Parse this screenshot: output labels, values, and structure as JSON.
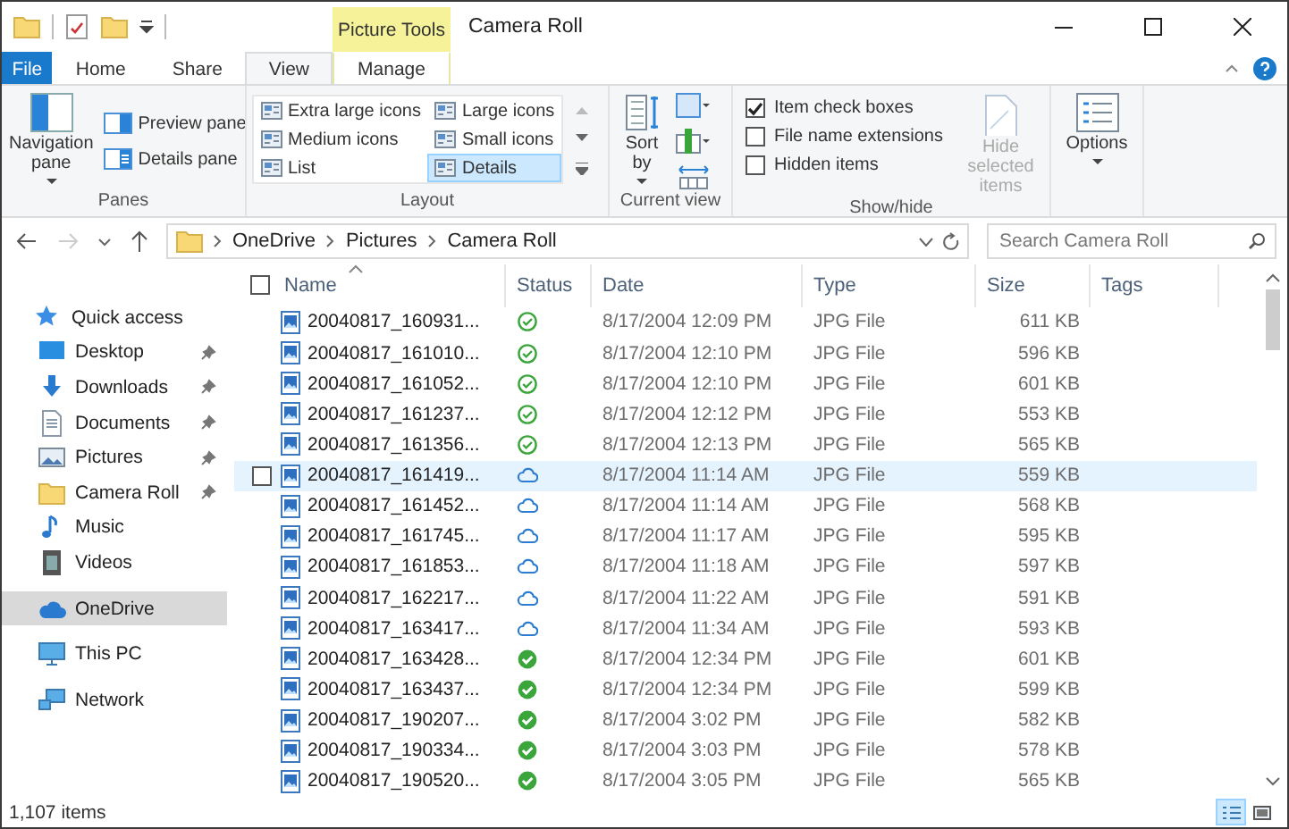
{
  "title_bar": {
    "contextual_tab": "Picture Tools",
    "title": "Camera Roll"
  },
  "ribbon_tabs": [
    {
      "label": "File",
      "kind": "file",
      "selected": false
    },
    {
      "label": "Home",
      "kind": "tab",
      "selected": false
    },
    {
      "label": "Share",
      "kind": "tab",
      "selected": false
    },
    {
      "label": "View",
      "kind": "tab",
      "selected": true
    },
    {
      "label": "Manage",
      "kind": "contextual",
      "selected": false
    }
  ],
  "ribbon": {
    "panes": {
      "label": "Panes",
      "navigation_pane": "Navigation pane",
      "preview_pane": "Preview pane",
      "details_pane": "Details pane"
    },
    "layout": {
      "label": "Layout",
      "options": [
        {
          "label": "Extra large icons",
          "selected": false
        },
        {
          "label": "Large icons",
          "selected": false
        },
        {
          "label": "Medium icons",
          "selected": false
        },
        {
          "label": "Small icons",
          "selected": false
        },
        {
          "label": "List",
          "selected": false
        },
        {
          "label": "Details",
          "selected": true
        }
      ]
    },
    "current_view": {
      "label": "Current view",
      "sort_by": "Sort by"
    },
    "show_hide": {
      "label": "Show/hide",
      "checkboxes": [
        {
          "label": "Item check boxes",
          "checked": true
        },
        {
          "label": "File name extensions",
          "checked": false
        },
        {
          "label": "Hidden items",
          "checked": false
        }
      ],
      "hide_selected": {
        "label": "Hide selected items",
        "disabled": true
      }
    },
    "options": {
      "label": "Options"
    }
  },
  "address_bar": {
    "path": [
      "OneDrive",
      "Pictures",
      "Camera Roll"
    ]
  },
  "search": {
    "placeholder": "Search Camera Roll"
  },
  "navigation": [
    {
      "label": "Quick access",
      "kind": "star",
      "pinned": false,
      "selected": false
    },
    {
      "label": "Desktop",
      "kind": "desktop",
      "pinned": true,
      "selected": false
    },
    {
      "label": "Downloads",
      "kind": "downloads",
      "pinned": true,
      "selected": false
    },
    {
      "label": "Documents",
      "kind": "documents",
      "pinned": true,
      "selected": false
    },
    {
      "label": "Pictures",
      "kind": "pictures",
      "pinned": true,
      "selected": false
    },
    {
      "label": "Camera Roll",
      "kind": "folder",
      "pinned": true,
      "selected": false
    },
    {
      "label": "Music",
      "kind": "music",
      "pinned": false,
      "selected": false
    },
    {
      "label": "Videos",
      "kind": "videos",
      "pinned": false,
      "selected": false
    },
    {
      "label": "OneDrive",
      "kind": "cloud",
      "pinned": false,
      "selected": true
    },
    {
      "label": "This PC",
      "kind": "pc",
      "pinned": false,
      "selected": false
    },
    {
      "label": "Network",
      "kind": "network",
      "pinned": false,
      "selected": false
    }
  ],
  "file_list": {
    "select_all_checked": false,
    "columns": [
      "Name",
      "Status",
      "Date",
      "Type",
      "Size",
      "Tags"
    ],
    "rows": [
      {
        "name": "20040817_160931...",
        "kind": "synced",
        "date": "8/17/2004 12:09 PM",
        "type": "JPG File",
        "size": "611 KB",
        "hovered": false
      },
      {
        "name": "20040817_161010...",
        "kind": "synced",
        "date": "8/17/2004 12:10 PM",
        "type": "JPG File",
        "size": "596 KB",
        "hovered": false
      },
      {
        "name": "20040817_161052...",
        "kind": "synced",
        "date": "8/17/2004 12:10 PM",
        "type": "JPG File",
        "size": "601 KB",
        "hovered": false
      },
      {
        "name": "20040817_161237...",
        "kind": "synced",
        "date": "8/17/2004 12:12 PM",
        "type": "JPG File",
        "size": "553 KB",
        "hovered": false
      },
      {
        "name": "20040817_161356...",
        "kind": "synced",
        "date": "8/17/2004 12:13 PM",
        "type": "JPG File",
        "size": "565 KB",
        "hovered": false
      },
      {
        "name": "20040817_161419...",
        "kind": "cloud",
        "date": "8/17/2004 11:14 AM",
        "type": "JPG File",
        "size": "559 KB",
        "hovered": true
      },
      {
        "name": "20040817_161452...",
        "kind": "cloud",
        "date": "8/17/2004 11:14 AM",
        "type": "JPG File",
        "size": "568 KB",
        "hovered": false
      },
      {
        "name": "20040817_161745...",
        "kind": "cloud",
        "date": "8/17/2004 11:17 AM",
        "type": "JPG File",
        "size": "595 KB",
        "hovered": false
      },
      {
        "name": "20040817_161853...",
        "kind": "cloud",
        "date": "8/17/2004 11:18 AM",
        "type": "JPG File",
        "size": "597 KB",
        "hovered": false
      },
      {
        "name": "20040817_162217...",
        "kind": "cloud",
        "date": "8/17/2004 11:22 AM",
        "type": "JPG File",
        "size": "591 KB",
        "hovered": false
      },
      {
        "name": "20040817_163417...",
        "kind": "cloud",
        "date": "8/17/2004 11:34 AM",
        "type": "JPG File",
        "size": "593 KB",
        "hovered": false
      },
      {
        "name": "20040817_163428...",
        "kind": "local",
        "date": "8/17/2004 12:34 PM",
        "type": "JPG File",
        "size": "601 KB",
        "hovered": false
      },
      {
        "name": "20040817_163437...",
        "kind": "local",
        "date": "8/17/2004 12:34 PM",
        "type": "JPG File",
        "size": "599 KB",
        "hovered": false
      },
      {
        "name": "20040817_190207...",
        "kind": "local",
        "date": "8/17/2004 3:02 PM",
        "type": "JPG File",
        "size": "582 KB",
        "hovered": false
      },
      {
        "name": "20040817_190334...",
        "kind": "local",
        "date": "8/17/2004 3:03 PM",
        "type": "JPG File",
        "size": "578 KB",
        "hovered": false
      },
      {
        "name": "20040817_190520...",
        "kind": "local",
        "date": "8/17/2004 3:05 PM",
        "type": "JPG File",
        "size": "565 KB",
        "hovered": false
      }
    ]
  },
  "status_bar": {
    "item_count": "1,107 items",
    "view_buttons": [
      {
        "kind": "details",
        "selected": true
      },
      {
        "kind": "large_icons",
        "selected": false
      }
    ]
  }
}
